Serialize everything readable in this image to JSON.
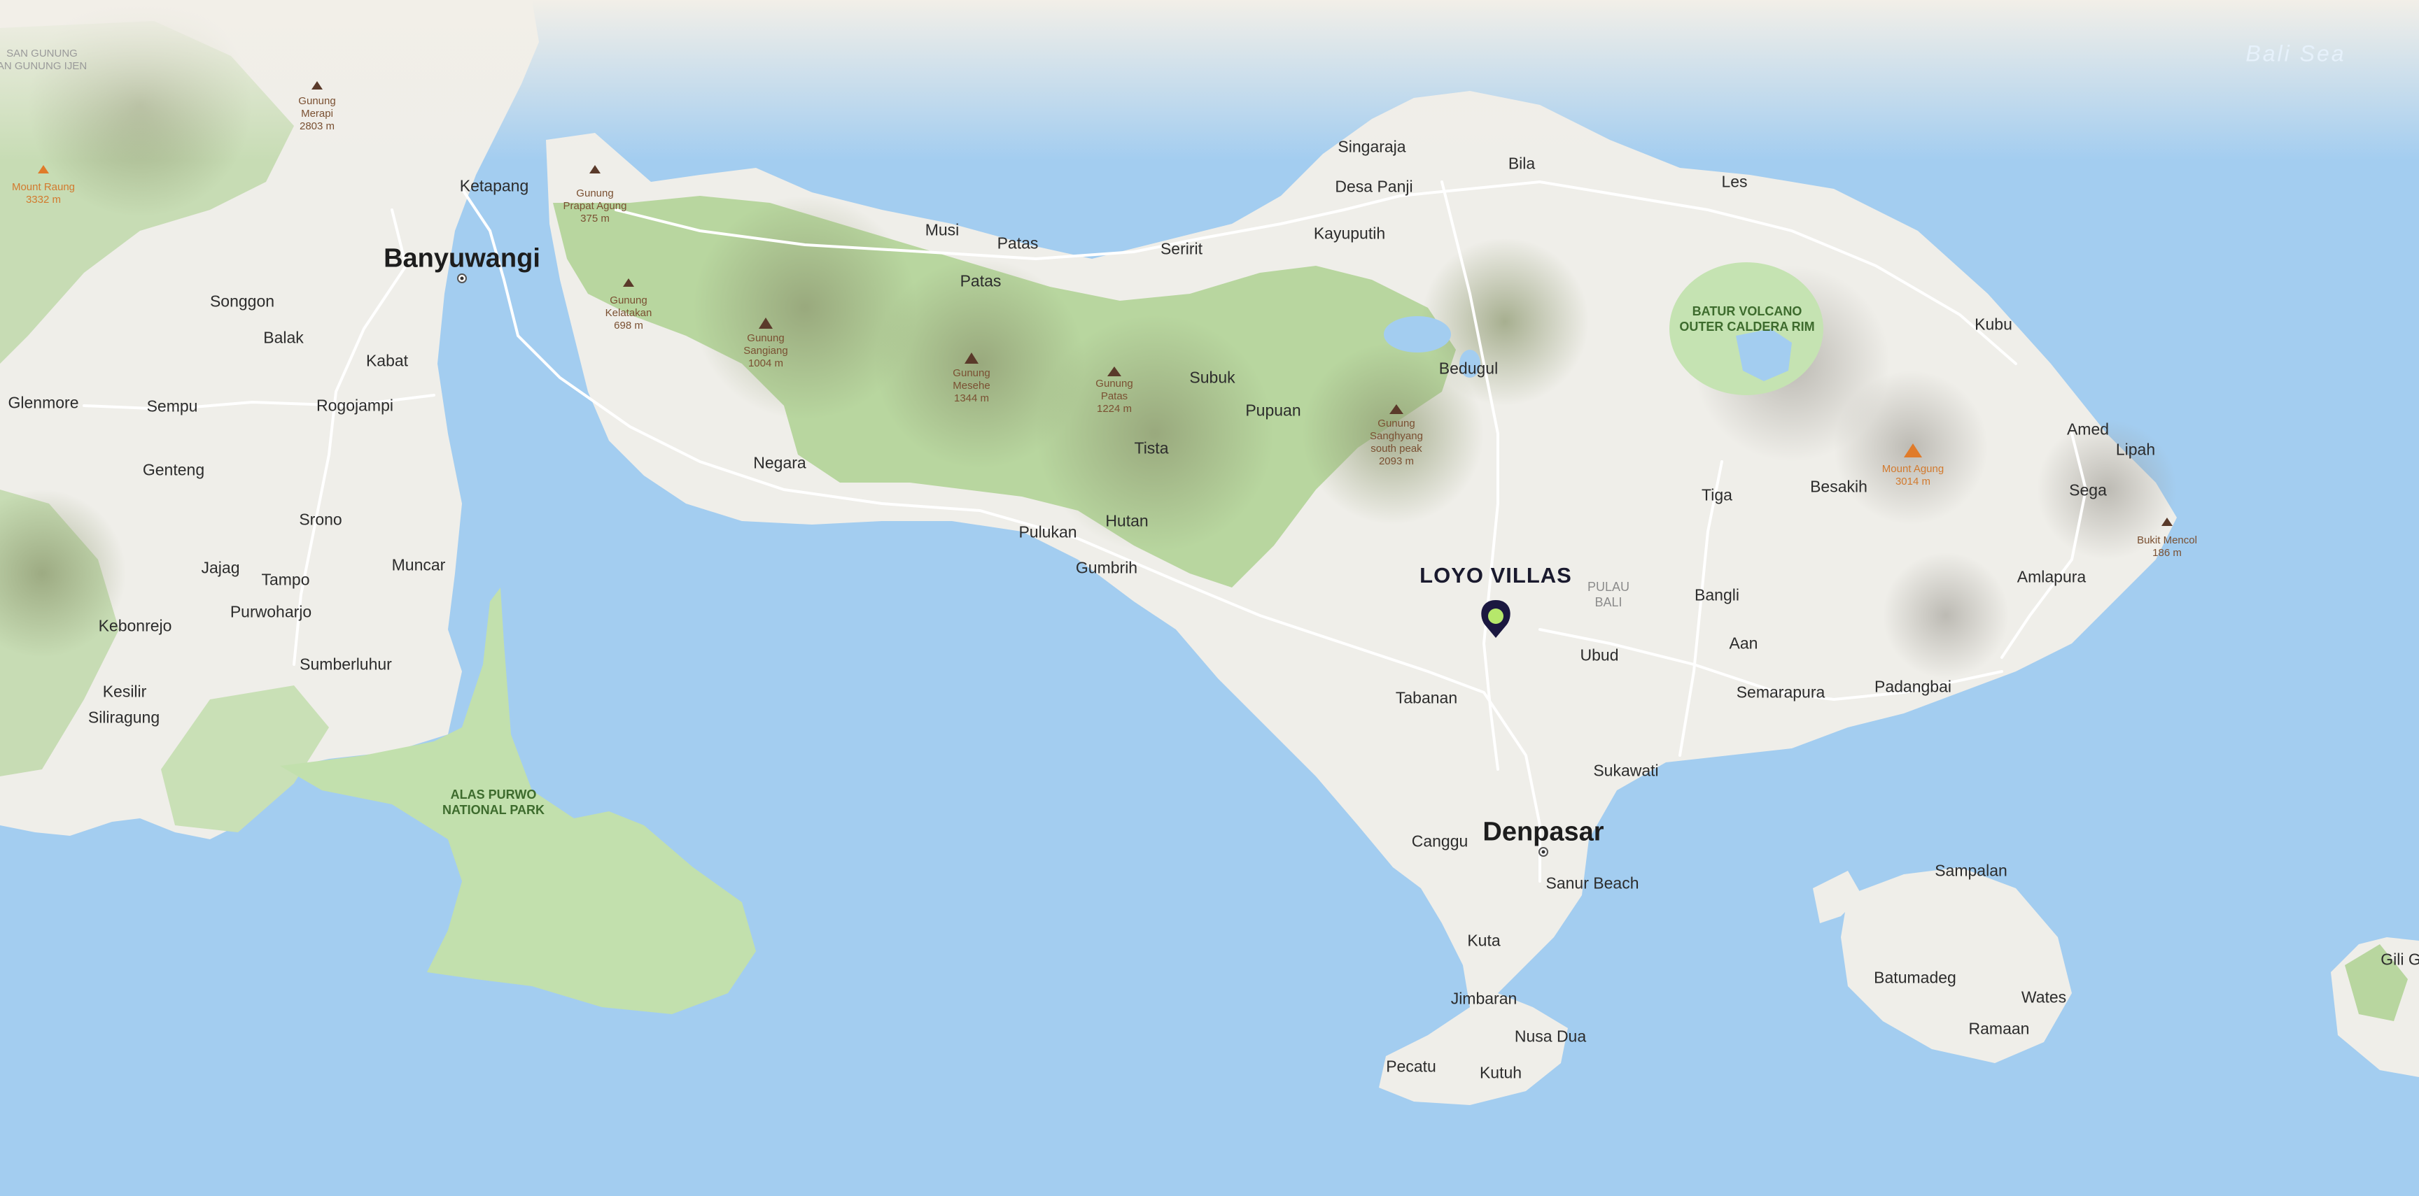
{
  "map": {
    "sea_label": "Bali Sea",
    "poi": {
      "name": "LOYO VILLAS",
      "pin_color": "#1b1840",
      "dot_color": "#b6e86b"
    },
    "colors": {
      "water": "#a3cdf0",
      "land": "#f1f0ec",
      "forest": "#b9d9a3",
      "park": "#c4e3b0"
    },
    "cities": [
      {
        "name": "Banyuwangi",
        "key": "banyuwangi"
      },
      {
        "name": "Denpasar",
        "key": "denpasar"
      }
    ],
    "towns": [
      {
        "name": "Singaraja",
        "key": "singaraja"
      },
      {
        "name": "Desa Panji",
        "key": "desa-panji"
      },
      {
        "name": "Bila",
        "key": "bila"
      },
      {
        "name": "Les",
        "key": "les"
      },
      {
        "name": "Kayuputih",
        "key": "kayuputih"
      },
      {
        "name": "Seririt",
        "key": "seririt"
      },
      {
        "name": "Musi",
        "key": "musi"
      },
      {
        "name": "Patas",
        "key": "patas-1"
      },
      {
        "name": "Patas",
        "key": "patas-2"
      },
      {
        "name": "Ketapang",
        "key": "ketapang"
      },
      {
        "name": "Songgon",
        "key": "songgon"
      },
      {
        "name": "Balak",
        "key": "balak"
      },
      {
        "name": "Kabat",
        "key": "kabat"
      },
      {
        "name": "Glenmore",
        "key": "glenmore"
      },
      {
        "name": "Sempu",
        "key": "sempu"
      },
      {
        "name": "Rogojampi",
        "key": "rogojampi"
      },
      {
        "name": "Genteng",
        "key": "genteng"
      },
      {
        "name": "Srono",
        "key": "srono"
      },
      {
        "name": "Jajag",
        "key": "jajag"
      },
      {
        "name": "Tampo",
        "key": "tampo"
      },
      {
        "name": "Muncar",
        "key": "muncar"
      },
      {
        "name": "Kebonrejo",
        "key": "kebonrejo"
      },
      {
        "name": "Purwoharjo",
        "key": "purwoharjo"
      },
      {
        "name": "Sumberluhur",
        "key": "sumberluhur"
      },
      {
        "name": "Kesilir",
        "key": "kesilir"
      },
      {
        "name": "Siliragung",
        "key": "siliragung"
      },
      {
        "name": "Bedugul",
        "key": "bedugul"
      },
      {
        "name": "Subuk",
        "key": "subuk"
      },
      {
        "name": "Pupuan",
        "key": "pupuan"
      },
      {
        "name": "Tista",
        "key": "tista"
      },
      {
        "name": "Negara",
        "key": "negara"
      },
      {
        "name": "Pulukan",
        "key": "pulukan"
      },
      {
        "name": "Hutan",
        "key": "hutan"
      },
      {
        "name": "Gumbrih",
        "key": "gumbrih"
      },
      {
        "name": "Kubu",
        "key": "kubu"
      },
      {
        "name": "Amed",
        "key": "amed"
      },
      {
        "name": "Lipah",
        "key": "lipah"
      },
      {
        "name": "Sega",
        "key": "sega"
      },
      {
        "name": "Besakih",
        "key": "besakih"
      },
      {
        "name": "Tiga",
        "key": "tiga"
      },
      {
        "name": "Amlapura",
        "key": "amlapura"
      },
      {
        "name": "Bangli",
        "key": "bangli"
      },
      {
        "name": "Aan",
        "key": "aan"
      },
      {
        "name": "Ubud",
        "key": "ubud"
      },
      {
        "name": "Semarapura",
        "key": "semarapura"
      },
      {
        "name": "Padangbai",
        "key": "padangbai"
      },
      {
        "name": "Tabanan",
        "key": "tabanan"
      },
      {
        "name": "Sukawati",
        "key": "sukawati"
      },
      {
        "name": "Canggu",
        "key": "canggu"
      },
      {
        "name": "Sanur Beach",
        "key": "sanur-beach"
      },
      {
        "name": "Kuta",
        "key": "kuta"
      },
      {
        "name": "Jimbaran",
        "key": "jimbaran"
      },
      {
        "name": "Nusa Dua",
        "key": "nusa-dua"
      },
      {
        "name": "Pecatu",
        "key": "pecatu"
      },
      {
        "name": "Kutuh",
        "key": "kutuh"
      },
      {
        "name": "Sampalan",
        "key": "sampalan"
      },
      {
        "name": "Batumadeg",
        "key": "batumadeg"
      },
      {
        "name": "Wates",
        "key": "wates"
      },
      {
        "name": "Ramaan",
        "key": "ramaan"
      },
      {
        "name": "Gili G",
        "key": "gili-g"
      }
    ],
    "parks": [
      {
        "name": "ALAS PURWO\nNATIONAL PARK",
        "key": "alas-purwo"
      },
      {
        "name": "BATUR VOLCANO\nOUTER CALDERA RIM",
        "key": "batur"
      },
      {
        "name": "PULAU\nBALI",
        "key": "pulau-bali"
      }
    ],
    "peaks": [
      {
        "name": "Gunung\nPrapat Agung\n375 m",
        "key": "prapat-agung"
      },
      {
        "name": "Gunung\nKelatakan\n698 m",
        "key": "kelatakan"
      },
      {
        "name": "Gunung\nSangiang\n1004 m",
        "key": "sangiang"
      },
      {
        "name": "Gunung\nMesehe\n1344 m",
        "key": "mesehe"
      },
      {
        "name": "Gunung\nPatas\n1224 m",
        "key": "gunung-patas"
      },
      {
        "name": "Gunung\nSanghyang\nsouth peak\n2093 m",
        "key": "sanghyang"
      },
      {
        "name": "Mount Agung\n3014 m",
        "key": "agung",
        "highlight": true
      },
      {
        "name": "Bukit Mencol\n186 m",
        "key": "mencol"
      },
      {
        "name": "Gunung\nMerapi\n2803 m",
        "key": "merapi"
      },
      {
        "name": "Mount Raung\n3332 m",
        "key": "raung",
        "highlight": true
      },
      {
        "name": "SAN GUNUNG\nAN GUNUNG IJEN",
        "key": "ijen"
      }
    ]
  }
}
